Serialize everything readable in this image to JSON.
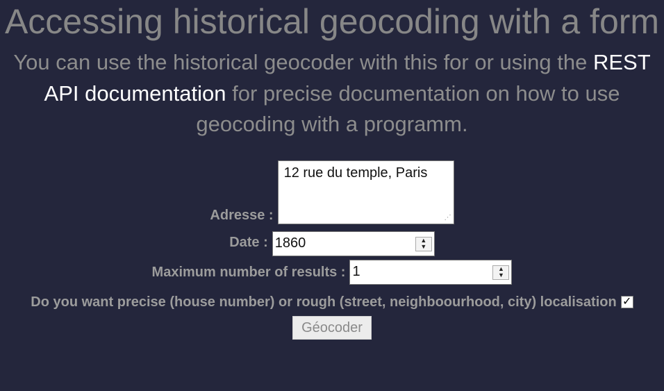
{
  "page": {
    "title": "Accessing historical geocoding with a form",
    "intro_before": "You can use the historical geocoder with this for or using the ",
    "intro_link": "REST API documentation",
    "intro_after": " for precise documentation on how to use geocoding with a programm."
  },
  "form": {
    "address_label": "Adresse :",
    "address_value": "12 rue du temple, Paris",
    "date_label": "Date :",
    "date_value": "1860",
    "max_results_label": "Maximum number of results :",
    "max_results_value": "1",
    "precise_label": "Do you want precise (house number) or rough (street, neighboourhood, city) localisation",
    "precise_checked": true,
    "checkmark": "✓",
    "submit_label": "Géocoder"
  },
  "icons": {
    "spinner": "spinner-arrows-icon",
    "resize": "resize-grip-icon",
    "check": "check-icon"
  }
}
